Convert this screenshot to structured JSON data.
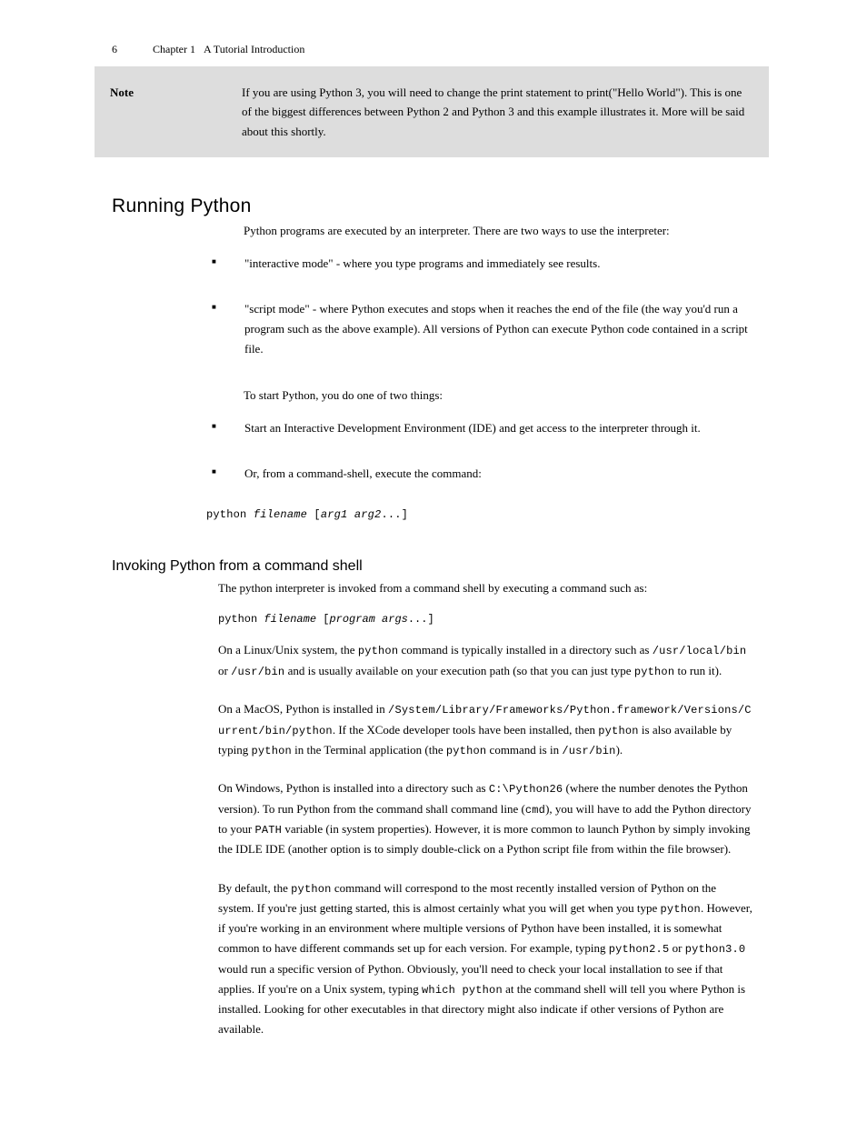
{
  "header": {
    "page_number": "6",
    "chapter": "Chapter 1",
    "chapter_title": "A Tutorial Introduction"
  },
  "note": {
    "label": "Note",
    "text": "If you are using Python 3, you will need to change the print statement to print(\"Hello World\"). This is one of the biggest differences between Python 2 and Python 3 and this example illustrates it. More will be said about this shortly."
  },
  "section_running": {
    "heading": "Running Python",
    "intro": "Python programs are executed by an interpreter. There are two ways to use the interpreter:",
    "bullets": [
      "\"interactive mode\" - where you type programs and immediately see results.",
      "\"script mode\" - where Python executes and stops when it reaches the end of the file (the way you'd run a program such as the above example). All versions of Python can execute Python code contained in a script file."
    ],
    "startup": "To start Python, you do one of two things:",
    "startup_bullets": {
      "item1": {
        "prefix": "Start an ",
        "ide": "Interactive Development Environment (IDE)",
        "suffix": " and get access to the interpreter through it."
      },
      "item2": {
        "prefix": "Or, from a command-shell, execute the command:",
        "cmd_p1": "python ",
        "cmd_filename": "filename",
        "cmd_p2": " [",
        "cmd_args": "arg1 arg2",
        "cmd_p3": "...]"
      }
    }
  },
  "section_cmdshell": {
    "heading": "Invoking Python from a command shell",
    "intro": "The python interpreter is invoked from a command shell by executing a command such as:",
    "cmd_p1": "python ",
    "cmd_filename": "filename",
    "cmd_p2": " [",
    "cmd_args": "program args",
    "cmd_p3": "...]",
    "para1_p1": "On a Linux/Unix system, the ",
    "para1_mono": "python",
    "para1_p2": " command is typically installed in a directory such as ",
    "para1_mono2": "/usr/local/bin",
    "para1_p3": " or ",
    "para1_mono3": "/usr/bin",
    "para1_p4": " and is usually available on your execution path (so that you can just type ",
    "para1_mono4": "python",
    "para1_p5": " to run it).",
    "para2_p1": "On a MacOS, Python is installed in ",
    "para2_mono": "/System/Library/Frameworks/Python.framework/Versions/Current/bin/python",
    "para2_p2": ". If the XCode developer tools have been installed, then ",
    "para2_mono2": "python",
    "para2_p3": " is also available by typing ",
    "para2_mono3": "python",
    "para2_p4": " in the Terminal application (the ",
    "para2_mono4": "python",
    "para2_p5": " command is in ",
    "para2_mono5": "/usr/bin",
    "para2_p6": ").",
    "para3_p1": "On Windows, Python is installed into a directory such as ",
    "para3_mono": "C:\\Python26",
    "para3_p2": " (where the number denotes the Python version). To run Python from the command shall command line (",
    "para3_mono2": "cmd",
    "para3_p3": "), you will have to add the Python directory to your ",
    "para3_mono3": "PATH",
    "para3_p4": " variable (in system properties). However, it is more common to launch Python by simply invoking the IDLE IDE (another option is to simply double-click on a Python script file from within the file browser).",
    "para4_p1": "By default, the ",
    "para4_mono": "python",
    "para4_p2": " command will correspond to the most recently installed version of Python on the system. If you're just getting started, this is almost certainly what you will get when you type ",
    "para4_mono2": "python",
    "para4_p3": ". However, if you're working in an environment where multiple versions of Python have been installed, it is somewhat common to have different commands set up for each version. For example, typing ",
    "para4_mono3": "python2.5",
    "para4_p4": " or ",
    "para4_mono4": "python3.0",
    "para4_p5": " would run a specific version of Python. Obviously, you'll need to check your local installation to see if that applies. If you're on a Unix system, typing ",
    "para4_mono5": "which python",
    "para4_p6": " at the command shell will tell you where Python is installed. Looking for other executables in that directory might also indicate if other versions of Python are available."
  }
}
